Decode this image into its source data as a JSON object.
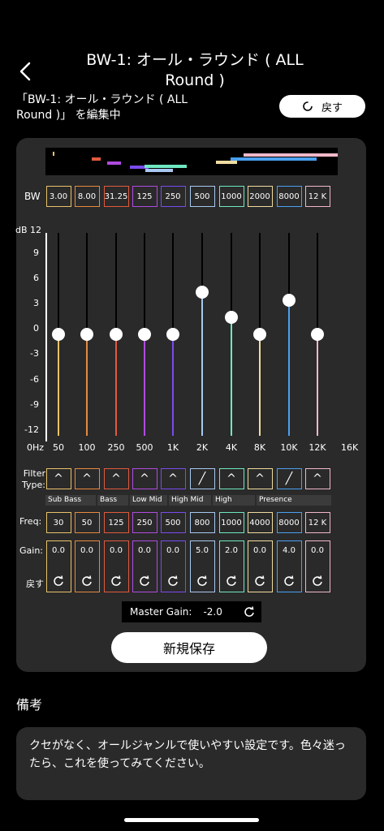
{
  "header": {
    "title_line1": "BW-1: オール・ラウンド ( ALL",
    "title_line2": "Round )",
    "editing_line1": "「BW-1: オール・ラウンド ( ALL",
    "editing_line2": "Round )」 を編集中",
    "restore_label": "戻す"
  },
  "eq": {
    "bw_label": "BW",
    "db_label": "dB 12",
    "db_ticks": [
      "9",
      "6",
      "3",
      "0",
      "-3",
      "-6",
      "-9",
      "-12"
    ],
    "hz_label": "0Hz",
    "hz_end_label": "16K",
    "filter_type_label": "Filter Type:",
    "freq_label": "Freq:",
    "gain_label": "Gain:",
    "reset_label": "戻す",
    "band_groups": [
      "Sub Bass",
      "Bass",
      "Low Mid",
      "High Mid",
      "High",
      "Presence"
    ],
    "bands": [
      {
        "bw": "3.00",
        "freq_tick": "50",
        "freq": "30",
        "gain": "0.0",
        "gain_value": 0.0,
        "filter": "^",
        "color": "#e8c26a"
      },
      {
        "bw": "8.00",
        "freq_tick": "100",
        "freq": "50",
        "gain": "0.0",
        "gain_value": 0.0,
        "filter": "^",
        "color": "#e8893f"
      },
      {
        "bw": "31.25",
        "freq_tick": "250",
        "freq": "125",
        "gain": "0.0",
        "gain_value": 0.0,
        "filter": "^",
        "color": "#e05a3e"
      },
      {
        "bw": "125",
        "freq_tick": "500",
        "freq": "250",
        "gain": "0.0",
        "gain_value": 0.0,
        "filter": "^",
        "color": "#b04be0"
      },
      {
        "bw": "250",
        "freq_tick": "1K",
        "freq": "500",
        "gain": "0.0",
        "gain_value": 0.0,
        "filter": "^",
        "color": "#7a4bf0"
      },
      {
        "bw": "500",
        "freq_tick": "2K",
        "freq": "800",
        "gain": "5.0",
        "gain_value": 5.0,
        "filter": "╱",
        "color": "#a8c8f0"
      },
      {
        "bw": "1000",
        "freq_tick": "4K",
        "freq": "1000",
        "gain": "2.0",
        "gain_value": 2.0,
        "filter": "^",
        "color": "#6ee8c0"
      },
      {
        "bw": "2000",
        "freq_tick": "8K",
        "freq": "4000",
        "gain": "0.0",
        "gain_value": 0.0,
        "filter": "^",
        "color": "#f0dca0"
      },
      {
        "bw": "8000",
        "freq_tick": "10K",
        "freq": "8000",
        "gain": "4.0",
        "gain_value": 4.0,
        "filter": "╱",
        "color": "#4aa0f0"
      },
      {
        "bw": "12 K",
        "freq_tick": "12K",
        "freq": "12 K",
        "gain": "0.0",
        "gain_value": 0.0,
        "filter": "^",
        "color": "#f0b8c8"
      }
    ],
    "gain_range": [
      -12,
      12
    ],
    "master_label": "Master Gain:",
    "master_value": "-2.0",
    "save_label": "新規保存"
  },
  "notes": {
    "title": "備考",
    "text": "クセがなく、オールジャンルで使いやすい設定です。色々迷ったら、これを使ってみてください。"
  }
}
